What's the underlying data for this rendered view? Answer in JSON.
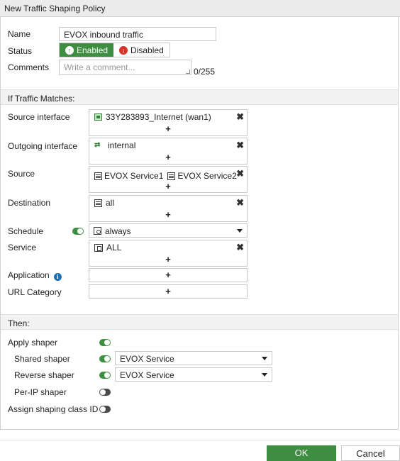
{
  "dialog": {
    "title": "New Traffic Shaping Policy"
  },
  "form": {
    "name_label": "Name",
    "name_value": "EVOX inbound traffic",
    "status_label": "Status",
    "status_enabled": "Enabled",
    "status_disabled": "Disabled",
    "comments_label": "Comments",
    "comments_placeholder": "Write a comment...",
    "comments_counter": "0/255"
  },
  "matches": {
    "header": "If Traffic Matches:",
    "source_interface_label": "Source interface",
    "source_interface_value": "33Y283893_Internet (wan1)",
    "outgoing_interface_label": "Outgoing interface",
    "outgoing_interface_value": "internal",
    "source_label": "Source",
    "source_values": [
      "EVOX Service1",
      "EVOX Service2"
    ],
    "destination_label": "Destination",
    "destination_value": "all",
    "schedule_label": "Schedule",
    "schedule_value": "always",
    "service_label": "Service",
    "service_value": "ALL",
    "application_label": "Application",
    "url_category_label": "URL Category",
    "add_symbol": "+",
    "remove_symbol": "✖"
  },
  "then": {
    "header": "Then:",
    "apply_shaper_label": "Apply shaper",
    "shared_shaper_label": "Shared shaper",
    "shared_shaper_value": "EVOX Service",
    "reverse_shaper_label": "Reverse shaper",
    "reverse_shaper_value": "EVOX Service",
    "per_ip_shaper_label": "Per-IP shaper",
    "assign_class_label": "Assign shaping class ID"
  },
  "footer": {
    "ok_label": "OK",
    "cancel_label": "Cancel"
  },
  "toggles": {
    "schedule": true,
    "apply_shaper": true,
    "shared_shaper": true,
    "reverse_shaper": true,
    "per_ip_shaper": false,
    "assign_class": false
  },
  "icons": {
    "status_enabled": "arrow-up-circle-icon",
    "status_disabled": "arrow-down-circle-icon",
    "source_interface": "network-port-icon",
    "outgoing_interface": "zone-icon",
    "address": "address-icon",
    "schedule": "schedule-icon",
    "service": "service-icon",
    "info": "info-icon",
    "remove": "close-icon",
    "dropdown": "chevron-down-icon"
  },
  "colors": {
    "accent": "#3e8e41",
    "danger": "#d9322b",
    "info": "#1f6fb2"
  }
}
